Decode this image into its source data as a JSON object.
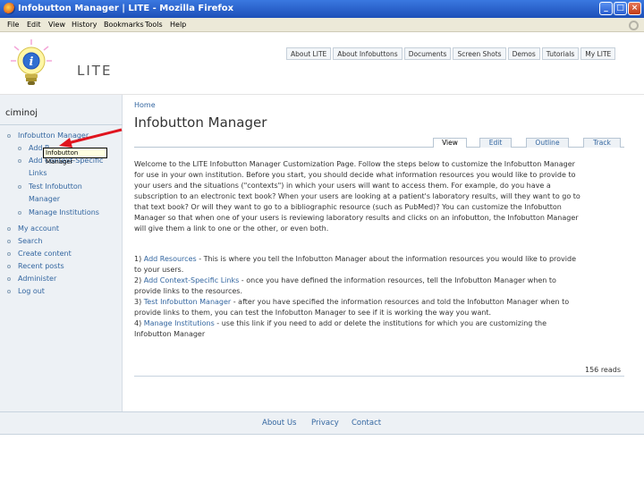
{
  "window": {
    "title": "Infobutton Manager | LITE - Mozilla Firefox",
    "minimize": "_",
    "maximize": "□",
    "close": "×"
  },
  "menubar": {
    "items": [
      "File",
      "Edit",
      "View",
      "History",
      "Bookmarks",
      "Tools",
      "Help"
    ]
  },
  "site": {
    "logo_text": "LITE"
  },
  "topnav": {
    "items": [
      "About LITE",
      "About Infobuttons",
      "Documents",
      "Screen Shots",
      "Demos",
      "Tutorials",
      "My LITE"
    ]
  },
  "sidebar": {
    "username": "ciminoj",
    "items": [
      "Infobutton Manager",
      "Add R",
      "Add Context-Specific",
      "Links",
      "Test Infobutton",
      "Manager",
      "Manage Institutions",
      "My account",
      "Search",
      "Create content",
      "Recent posts",
      "Administer",
      "Log out"
    ],
    "tooltip": "Infobutton Manager"
  },
  "main": {
    "breadcrumb": "Home",
    "title": "Infobutton Manager",
    "tabs": [
      "View",
      "Edit",
      "Outline",
      "Track"
    ],
    "intro": [
      "Welcome to the LITE Infobutton Manager Customization Page. Follow the steps below to customize the Infobutton Manager",
      "for use in your own institution. Before you start, you should decide what information resources you would like to provide to",
      "your users and the situations (\"contexts\") in which your users will want to access them. For example, do you have a",
      "subscription to an electronic text book? When your users are looking at a patient's laboratory results, will they want to go to",
      "that text book? Or will they want to go to a bibliographic resource (such as PubMed)? You can customize the Infobutton",
      "Manager so that when one of your users is reviewing laboratory results and clicks on an infobutton, the Infobutton Manager",
      "will give them a link to one or the other, or even both."
    ],
    "steps": [
      {
        "num": "1)",
        "link": "Add Resources",
        "text": " - This is where you tell the Infobutton Manager about the information resources you would like to provide"
      },
      {
        "num": "",
        "link": "",
        "text": "to your users."
      },
      {
        "num": "2)",
        "link": "Add Context-Specific Links",
        "text": " - once you have defined the information resources, tell the Infobutton Manager when to"
      },
      {
        "num": "",
        "link": "",
        "text": "provide links to the resources."
      },
      {
        "num": "3)",
        "link": "Test Infobutton Manager",
        "text": " - after you have specified the information resources and told the Infobutton Manager when to"
      },
      {
        "num": "",
        "link": "",
        "text": "provide links to them, you can test the Infobutton Manager to see if it is working the way you want."
      },
      {
        "num": "4)",
        "link": "Manage Institutions",
        "text": " - use this link if you need to add or delete the institutions for which you are customizing the"
      },
      {
        "num": "",
        "link": "",
        "text": "Infobutton Manager"
      }
    ],
    "reads": "156 reads"
  },
  "footer": {
    "links": [
      "About Us",
      "Privacy",
      "Contact"
    ]
  },
  "colors": {
    "link": "#3366a0",
    "sidebar_bg": "#edf1f5",
    "titlebar": "#1d4fb8",
    "arrow": "#e0141e"
  }
}
